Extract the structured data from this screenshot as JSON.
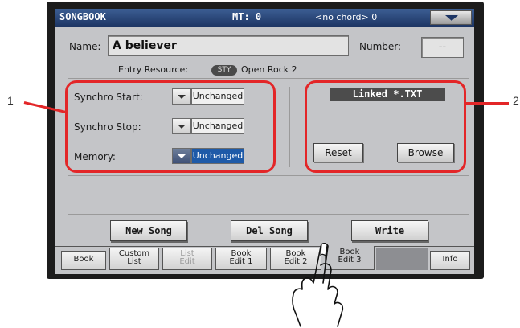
{
  "header": {
    "title": "SONGBOOK",
    "mt": "MT: 0",
    "chord": "<no chord> 0",
    "menu_icon": "chevron-down-icon"
  },
  "entry": {
    "name_label": "Name:",
    "name_value": "A believer",
    "number_label": "Number:",
    "number_value": "--",
    "resource_label": "Entry Resource:",
    "resource_badge": "STY",
    "resource_value": "Open Rock 2"
  },
  "synchro": {
    "start_label": "Synchro Start:",
    "start_value": "Unchanged",
    "stop_label": "Synchro Stop:",
    "stop_value": "Unchanged",
    "memory_label": "Memory:",
    "memory_value": "Unchanged"
  },
  "linked": {
    "title": "Linked *.TXT",
    "reset_label": "Reset",
    "browse_label": "Browse"
  },
  "actions": {
    "new_song": "New Song",
    "del_song": "Del Song",
    "write": "Write"
  },
  "tabs": [
    {
      "line1": "Book",
      "line2": ""
    },
    {
      "line1": "Custom",
      "line2": "List"
    },
    {
      "line1": "List",
      "line2": "Edit"
    },
    {
      "line1": "Book",
      "line2": "Edit 1"
    },
    {
      "line1": "Book",
      "line2": "Edit 2"
    },
    {
      "line1": "Book",
      "line2": "Edit 3"
    },
    {
      "line1": "Info",
      "line2": ""
    }
  ],
  "callouts": {
    "left": "1",
    "right": "2"
  },
  "colors": {
    "header_blue": "#1d3564",
    "selected_blue": "#1e5aa8",
    "highlight_red": "#e32628",
    "screen_gray": "#c4c5c8"
  }
}
